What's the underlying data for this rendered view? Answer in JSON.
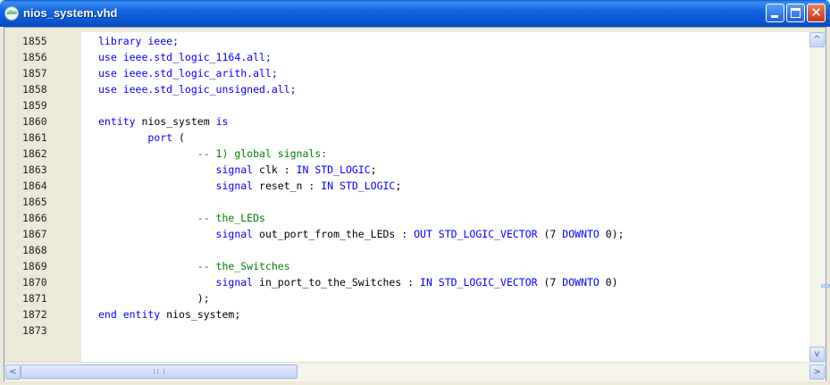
{
  "window": {
    "title": "nios_system.vhd",
    "app_icon_text": "abo",
    "close_glyph": "✕",
    "title_color": "#ffffff",
    "titlebar_color": "#0a56d0"
  },
  "scroll": {
    "left_arrow": "<",
    "right_arrow": ">",
    "up_arrow": "^",
    "down_arrow": "v"
  },
  "colors": {
    "keyword": "#0000ff",
    "comment": "#008000",
    "text": "#000000",
    "gutter": "#ece9d8"
  },
  "editor": {
    "lines": [
      {
        "num": "1855",
        "fold": false,
        "segs": [
          {
            "t": "library ieee;",
            "c": "kw"
          }
        ]
      },
      {
        "num": "1856",
        "fold": false,
        "segs": [
          {
            "t": "use ieee.std_logic_1164.all;",
            "c": "kw"
          }
        ]
      },
      {
        "num": "1857",
        "fold": false,
        "segs": [
          {
            "t": "use ieee.std_logic_arith.all;",
            "c": "kw"
          }
        ]
      },
      {
        "num": "1858",
        "fold": false,
        "segs": [
          {
            "t": "use ieee.std_logic_unsigned.all;",
            "c": "kw"
          }
        ]
      },
      {
        "num": "1859",
        "fold": false,
        "segs": []
      },
      {
        "num": "1860",
        "fold": true,
        "segs": [
          {
            "t": "entity ",
            "c": "kw"
          },
          {
            "t": "nios_system ",
            "c": "tx"
          },
          {
            "t": "is",
            "c": "kw"
          }
        ]
      },
      {
        "num": "1861",
        "fold": true,
        "segs": [
          {
            "t": "        port ",
            "c": "kw"
          },
          {
            "t": "(",
            "c": "tx"
          }
        ]
      },
      {
        "num": "1862",
        "fold": false,
        "segs": [
          {
            "t": "                -- 1) global signals:",
            "c": "cm"
          }
        ]
      },
      {
        "num": "1863",
        "fold": false,
        "segs": [
          {
            "t": "                   signal ",
            "c": "kw"
          },
          {
            "t": "clk : ",
            "c": "tx"
          },
          {
            "t": "IN STD_LOGIC",
            "c": "kw"
          },
          {
            "t": ";",
            "c": "tx"
          }
        ]
      },
      {
        "num": "1864",
        "fold": false,
        "segs": [
          {
            "t": "                   signal ",
            "c": "kw"
          },
          {
            "t": "reset_n : ",
            "c": "tx"
          },
          {
            "t": "IN STD_LOGIC",
            "c": "kw"
          },
          {
            "t": ";",
            "c": "tx"
          }
        ]
      },
      {
        "num": "1865",
        "fold": false,
        "segs": []
      },
      {
        "num": "1866",
        "fold": false,
        "segs": [
          {
            "t": "                -- the_LEDs",
            "c": "cm"
          }
        ]
      },
      {
        "num": "1867",
        "fold": false,
        "segs": [
          {
            "t": "                   signal ",
            "c": "kw"
          },
          {
            "t": "out_port_from_the_LEDs : ",
            "c": "tx"
          },
          {
            "t": "OUT STD_LOGIC_VECTOR ",
            "c": "kw"
          },
          {
            "t": "(7 ",
            "c": "tx"
          },
          {
            "t": "DOWNTO ",
            "c": "kw"
          },
          {
            "t": "0);",
            "c": "tx"
          }
        ]
      },
      {
        "num": "1868",
        "fold": false,
        "segs": []
      },
      {
        "num": "1869",
        "fold": false,
        "segs": [
          {
            "t": "                -- the_Switches",
            "c": "cm"
          }
        ]
      },
      {
        "num": "1870",
        "fold": false,
        "segs": [
          {
            "t": "                   signal ",
            "c": "kw"
          },
          {
            "t": "in_port_to_the_Switches : ",
            "c": "tx"
          },
          {
            "t": "IN STD_LOGIC_VECTOR ",
            "c": "kw"
          },
          {
            "t": "(7 ",
            "c": "tx"
          },
          {
            "t": "DOWNTO ",
            "c": "kw"
          },
          {
            "t": "0)",
            "c": "tx"
          }
        ]
      },
      {
        "num": "1871",
        "fold": false,
        "segs": [
          {
            "t": "                );",
            "c": "tx"
          }
        ]
      },
      {
        "num": "1872",
        "fold": false,
        "segs": [
          {
            "t": "end entity ",
            "c": "kw"
          },
          {
            "t": "nios_system;",
            "c": "tx"
          }
        ]
      },
      {
        "num": "1873",
        "fold": false,
        "segs": []
      }
    ]
  }
}
